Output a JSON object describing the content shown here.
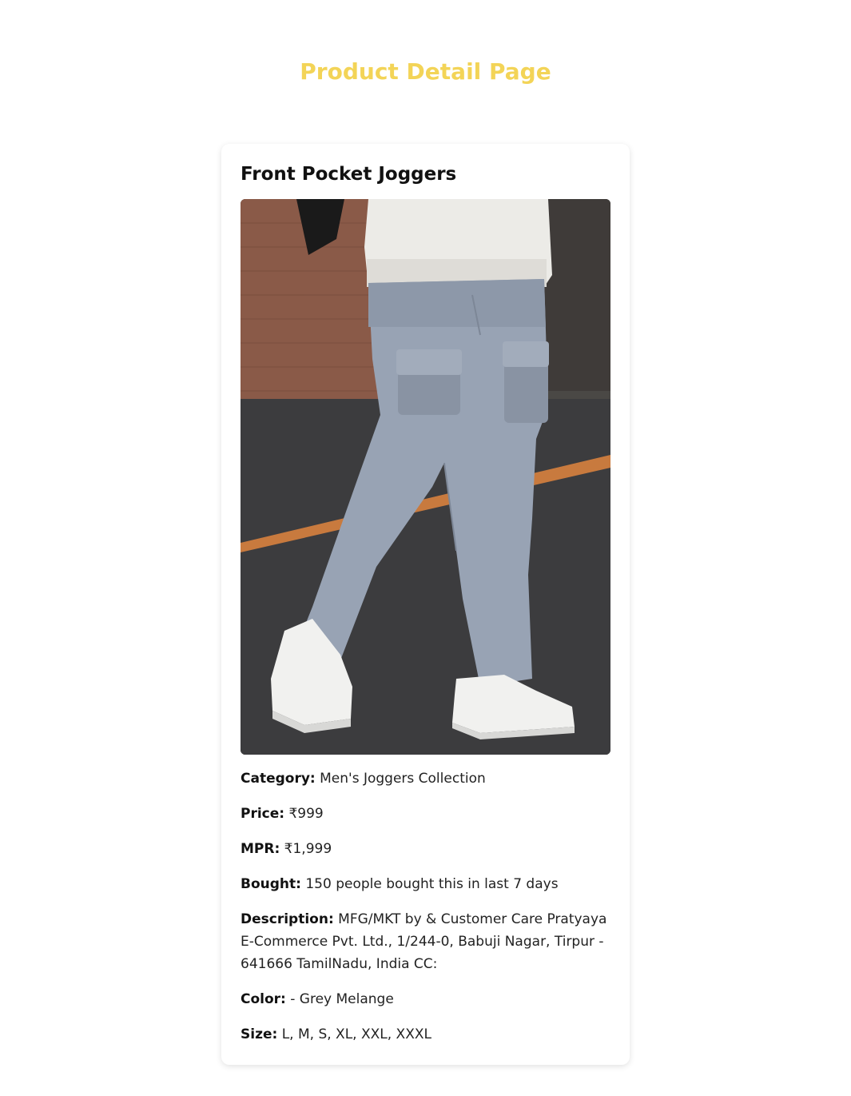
{
  "page": {
    "title": "Product Detail Page"
  },
  "product": {
    "name": "Front Pocket Joggers",
    "image_alt": "Grey melange front pocket joggers with white sneakers",
    "details": [
      {
        "label": "Category:",
        "value": "Men's Joggers Collection"
      },
      {
        "label": "Price:",
        "value": "₹999"
      },
      {
        "label": "MPR:",
        "value": "₹1,999"
      },
      {
        "label": "Bought:",
        "value": "150 people bought this in last 7 days"
      },
      {
        "label": "Description:",
        "value": "MFG/MKT by & Customer Care Pratyaya E-Commerce Pvt. Ltd., 1/244-0, Babuji Nagar, Tirpur - 641666 TamilNadu, India CC:"
      },
      {
        "label": "Color:",
        "value": "- Grey Melange"
      },
      {
        "label": "Size:",
        "value": "L, M, S, XL, XXL, XXXL"
      }
    ]
  },
  "colors": {
    "title": "#f3d457",
    "card_bg": "#ffffff",
    "text": "#111111"
  }
}
